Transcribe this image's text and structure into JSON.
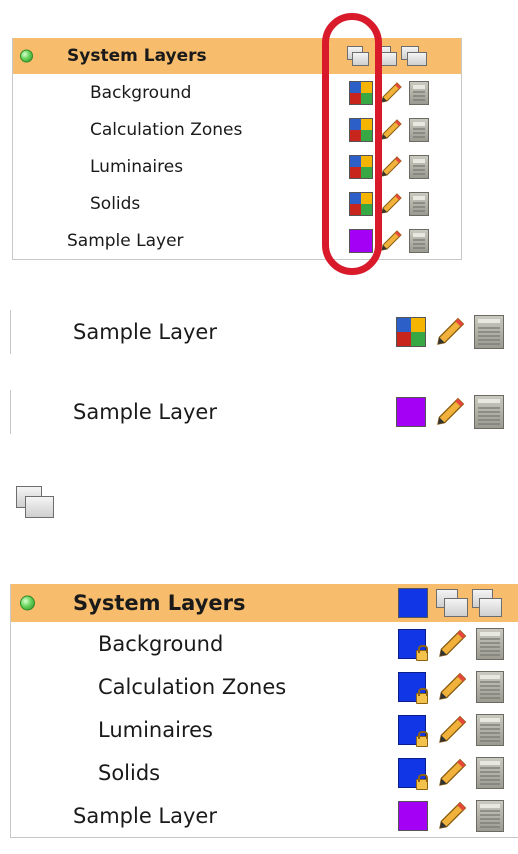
{
  "panel1": {
    "header_label": "System Layers",
    "rows": [
      {
        "label": "Background"
      },
      {
        "label": "Calculation Zones"
      },
      {
        "label": "Luminaires"
      },
      {
        "label": "Solids"
      }
    ],
    "sample_label": "Sample Layer"
  },
  "single1": {
    "label": "Sample Layer"
  },
  "single2": {
    "label": "Sample Layer"
  },
  "panel2": {
    "header_label": "System Layers",
    "rows": [
      {
        "label": "Background"
      },
      {
        "label": "Calculation Zones"
      },
      {
        "label": "Luminaires"
      },
      {
        "label": "Solids"
      }
    ],
    "sample_label": "Sample Layer"
  },
  "colors": {
    "header_bg": "#f7bd6c",
    "highlight_circle": "#d81a2b",
    "sample_purple": "#a300f5",
    "system_blue": "#1036e6"
  },
  "icons": [
    "status-dot-icon",
    "layer-stack-icon",
    "color-swatch-icon",
    "pencil-icon",
    "calculator-icon",
    "lock-icon"
  ]
}
